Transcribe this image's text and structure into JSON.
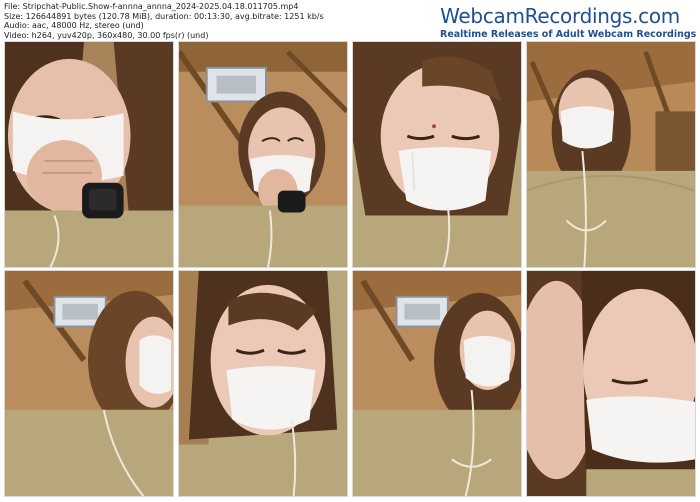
{
  "info": {
    "file_line": "File: Stripchat-Public.Show-f-annna_annna_2024-2025.04.18.011705.mp4",
    "size_line": "Size: 126644891 bytes (120.78 MiB), duration: 00:13:30, avg.bitrate: 1251 kb/s",
    "audio_line": "Audio: aac, 48000 Hz, stereo (und)",
    "video_line": "Video: h264, yuv420p, 360x480, 30.00 fps(r) (und)"
  },
  "brand": {
    "logo": "WebcamRecordings.com",
    "tagline": "Realtime Releases of Adult Webcam Recordings"
  },
  "colors": {
    "brand_blue": "#1f4f93",
    "wood": "#b08a58",
    "shirt": "#b7a77a",
    "hair": "#5a3a22",
    "skin": "#e8c3b0",
    "mask": "#f4f2ef"
  },
  "thumbnails": [
    {
      "scene": "close-up, hand over mouth, watch visible"
    },
    {
      "scene": "hand on mask, ceiling vent behind"
    },
    {
      "scene": "close-up, eyes nearly closed"
    },
    {
      "scene": "head tilted back, wood ceiling"
    },
    {
      "scene": "looking down, ceiling vent behind"
    },
    {
      "scene": "close-up, eyes half closed"
    },
    {
      "scene": "head tilted, ceiling vent behind"
    },
    {
      "scene": "very close-up, face resting on hand"
    }
  ]
}
